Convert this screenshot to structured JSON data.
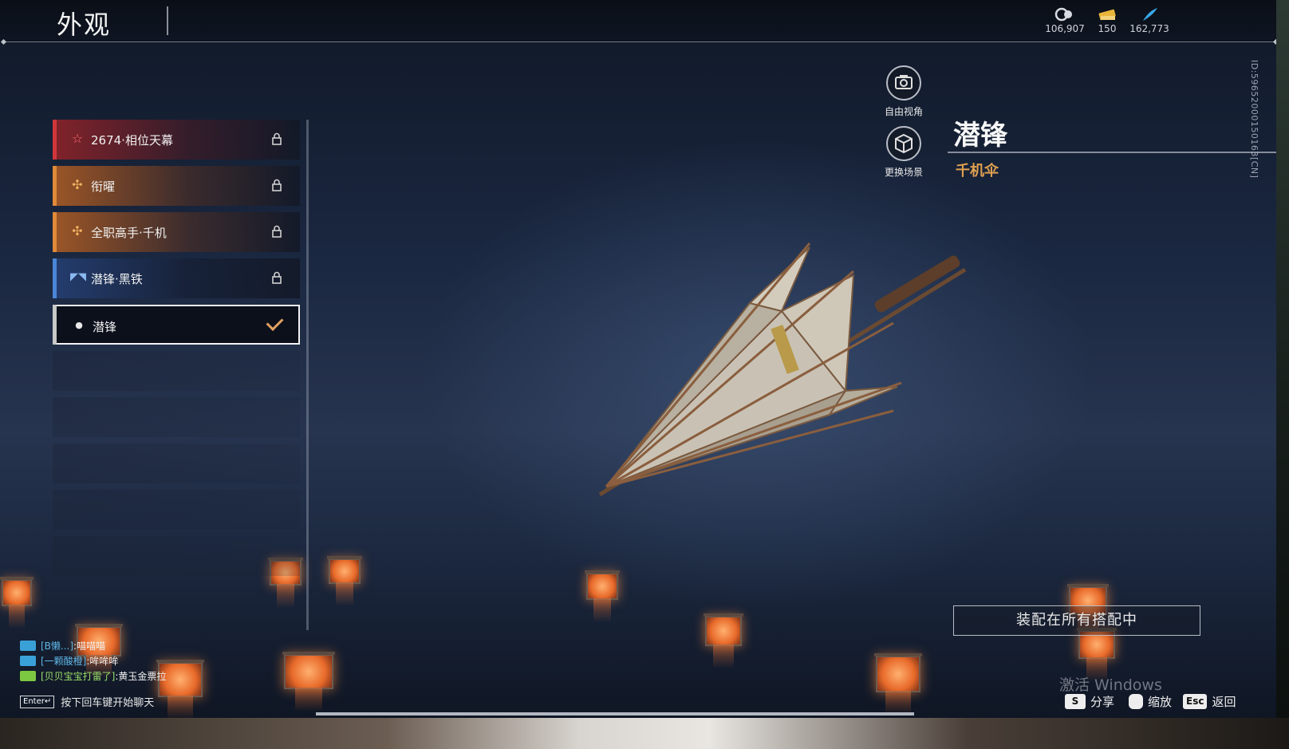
{
  "header": {
    "title": "外观",
    "currencies": [
      {
        "icon": "currency-coin-icon",
        "value": "106,907"
      },
      {
        "icon": "currency-ticket-icon",
        "value": "150"
      },
      {
        "icon": "currency-feather-icon",
        "value": "162,773"
      }
    ]
  },
  "side_id": "ID:5965200015016​3[CN]",
  "appearance_list": [
    {
      "label": "2674·相位天幕",
      "icon": "star-icon",
      "state": "locked",
      "rarity": "red"
    },
    {
      "label": "衔曜",
      "icon": "cross-petal-icon",
      "state": "locked",
      "rarity": "orange"
    },
    {
      "label": "全职高手·千机",
      "icon": "cross-petal-icon",
      "state": "locked",
      "rarity": "orange"
    },
    {
      "label": "潜锋·黑铁",
      "icon": "wing-icon",
      "state": "locked",
      "rarity": "blue"
    },
    {
      "label": "潜锋",
      "icon": "drop-icon",
      "state": "equipped",
      "rarity": "white"
    }
  ],
  "view_controls": {
    "free_camera": "自由视角",
    "change_scene": "更换场景"
  },
  "item": {
    "name": "潜锋",
    "type": "千机伞"
  },
  "actions": {
    "equip_all": "装配在所有搭配中"
  },
  "watermark": "激活 Windows",
  "hints": {
    "share_key": "S",
    "share_label": "分享",
    "zoom_label": "缩放",
    "back_key": "Esc",
    "back_label": "返回"
  },
  "chat": {
    "lines": [
      {
        "name": "[B懒...]",
        "message": ":喵喵喵"
      },
      {
        "name": "[一颗酸橙]",
        "message": ":哞哞哞"
      },
      {
        "name": "[贝贝宝宝打雷了]",
        "message": ":黄玉金票拉"
      }
    ],
    "enter_key": "Enter↵",
    "enter_hint": "按下回车键开始聊天"
  },
  "colors": {
    "accent_orange": "#e0a050",
    "rarity_red": "#d0363c",
    "rarity_orange": "#e08a38",
    "rarity_blue": "#4a86d8"
  }
}
